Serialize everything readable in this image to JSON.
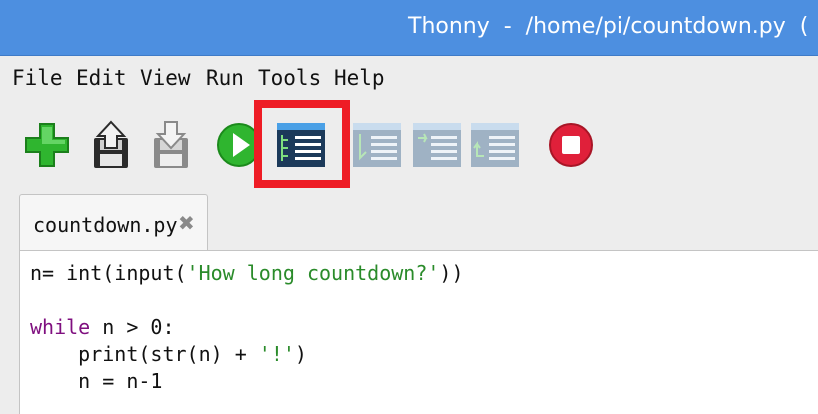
{
  "window": {
    "title": "Thonny  -  /home/pi/countdown.py  ("
  },
  "menu": {
    "items": [
      "File",
      "Edit",
      "View",
      "Run",
      "Tools",
      "Help"
    ]
  },
  "toolbar": {
    "buttons": [
      {
        "icon": "new-file-icon"
      },
      {
        "icon": "load-file-icon"
      },
      {
        "icon": "save-file-icon"
      },
      {
        "icon": "run-icon"
      },
      {
        "icon": "debug-icon",
        "highlighted": true
      },
      {
        "icon": "step-over-icon"
      },
      {
        "icon": "step-into-icon"
      },
      {
        "icon": "step-out-icon"
      },
      {
        "icon": "stop-icon"
      }
    ],
    "highlight_color": "#ee1c25"
  },
  "editor": {
    "tab": {
      "label": "countdown.py",
      "close": "✖"
    },
    "lines": [
      {
        "parts": [
          [
            "n= int(input(",
            "plain"
          ],
          [
            "'How long countdown?'",
            "str"
          ],
          [
            "))",
            "plain"
          ]
        ]
      },
      {
        "parts": [
          [
            "",
            "plain"
          ]
        ]
      },
      {
        "parts": [
          [
            "while",
            "kw"
          ],
          [
            " n > 0:",
            "plain"
          ]
        ]
      },
      {
        "parts": [
          [
            "    print(str(n) + ",
            "plain"
          ],
          [
            "'!'",
            "str"
          ],
          [
            ")",
            "plain"
          ]
        ]
      },
      {
        "parts": [
          [
            "    n = n-1",
            "plain"
          ]
        ]
      }
    ]
  },
  "colors": {
    "titlebar": "#4d8fe0",
    "keyword": "#7f0f7f",
    "string": "#2a8b2a"
  }
}
